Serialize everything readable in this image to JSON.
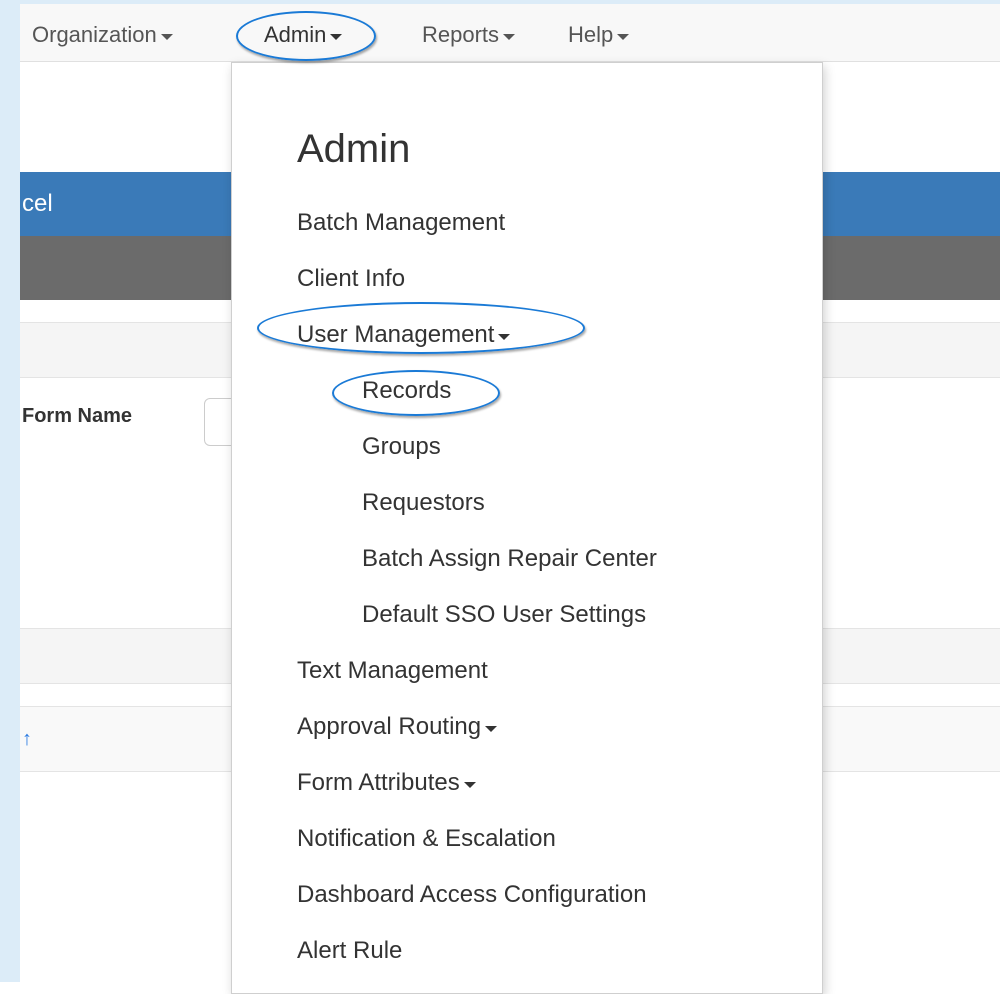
{
  "navbar": {
    "items": [
      {
        "label": "Organization"
      },
      {
        "label": "Admin"
      },
      {
        "label": "Reports"
      },
      {
        "label": "Help"
      }
    ]
  },
  "background": {
    "panel_title_fragment": "cel",
    "form_name_label": "Form Name",
    "sort_icon": "↑"
  },
  "dropdown": {
    "title": "Admin",
    "items": [
      {
        "label": "Batch Management"
      },
      {
        "label": "Client Info"
      },
      {
        "label": "User Management"
      },
      {
        "label": "Records"
      },
      {
        "label": "Groups"
      },
      {
        "label": "Requestors"
      },
      {
        "label": "Batch Assign Repair Center"
      },
      {
        "label": "Default SSO User Settings"
      },
      {
        "label": "Text Management"
      },
      {
        "label": "Approval Routing"
      },
      {
        "label": "Form Attributes"
      },
      {
        "label": "Notification & Escalation"
      },
      {
        "label": "Dashboard Access Configuration"
      },
      {
        "label": "Alert Rule"
      }
    ]
  },
  "colors": {
    "highlight_circle": "#1a7ad6",
    "panel_header": "#3a7ab8",
    "panel_subheader": "#6b6b6b",
    "left_strip": "#dcecf8"
  }
}
